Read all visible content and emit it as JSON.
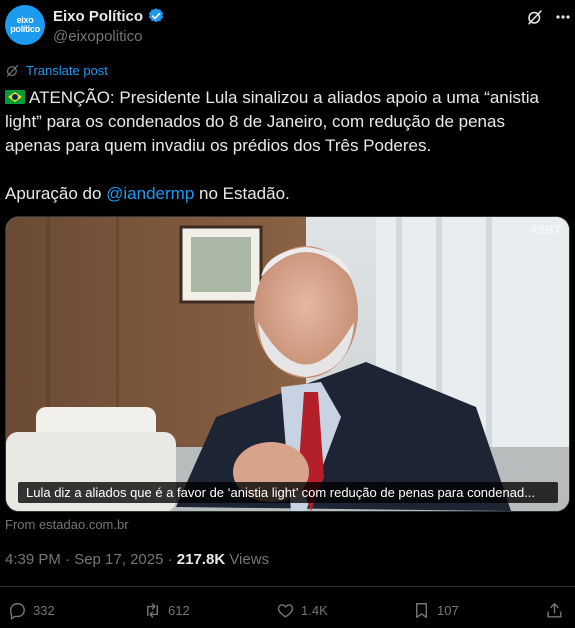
{
  "author": {
    "avatar_text_line1": "eixo",
    "avatar_text_line2": "político",
    "display_name": "Eixo Político",
    "handle": "@eixopolitico",
    "verified_color": "#1d9bf0"
  },
  "translate_label": "Translate post",
  "post": {
    "line1_prefix": "ATENÇÃO: Presidente Lula sinalizou a aliados apoio a uma “anistia light” para os condenados do 8 de Janeiro, com redução de penas apenas para quem invadiu os prédios dos Três Poderes.",
    "line2_before": "Apuração do ",
    "line2_mention": "@iandermp",
    "line2_after": " no Estadão."
  },
  "media": {
    "watermark": "#SBT",
    "caption": "Lula diz a aliados que é a favor de ‘anistia light’ com redução de penas para condenad..."
  },
  "source": "From estadao.com.br",
  "meta": {
    "timestamp": "4:39 PM · Sep 17, 2025 · ",
    "views_count": "217.8K",
    "views_label": " Views"
  },
  "actions": {
    "replies": "332",
    "reposts": "612",
    "likes": "1.4K",
    "bookmarks": "107"
  },
  "colors": {
    "background": "#000000",
    "text": "#e7e9ea",
    "secondary": "#71767b",
    "accent": "#1d9bf0"
  }
}
